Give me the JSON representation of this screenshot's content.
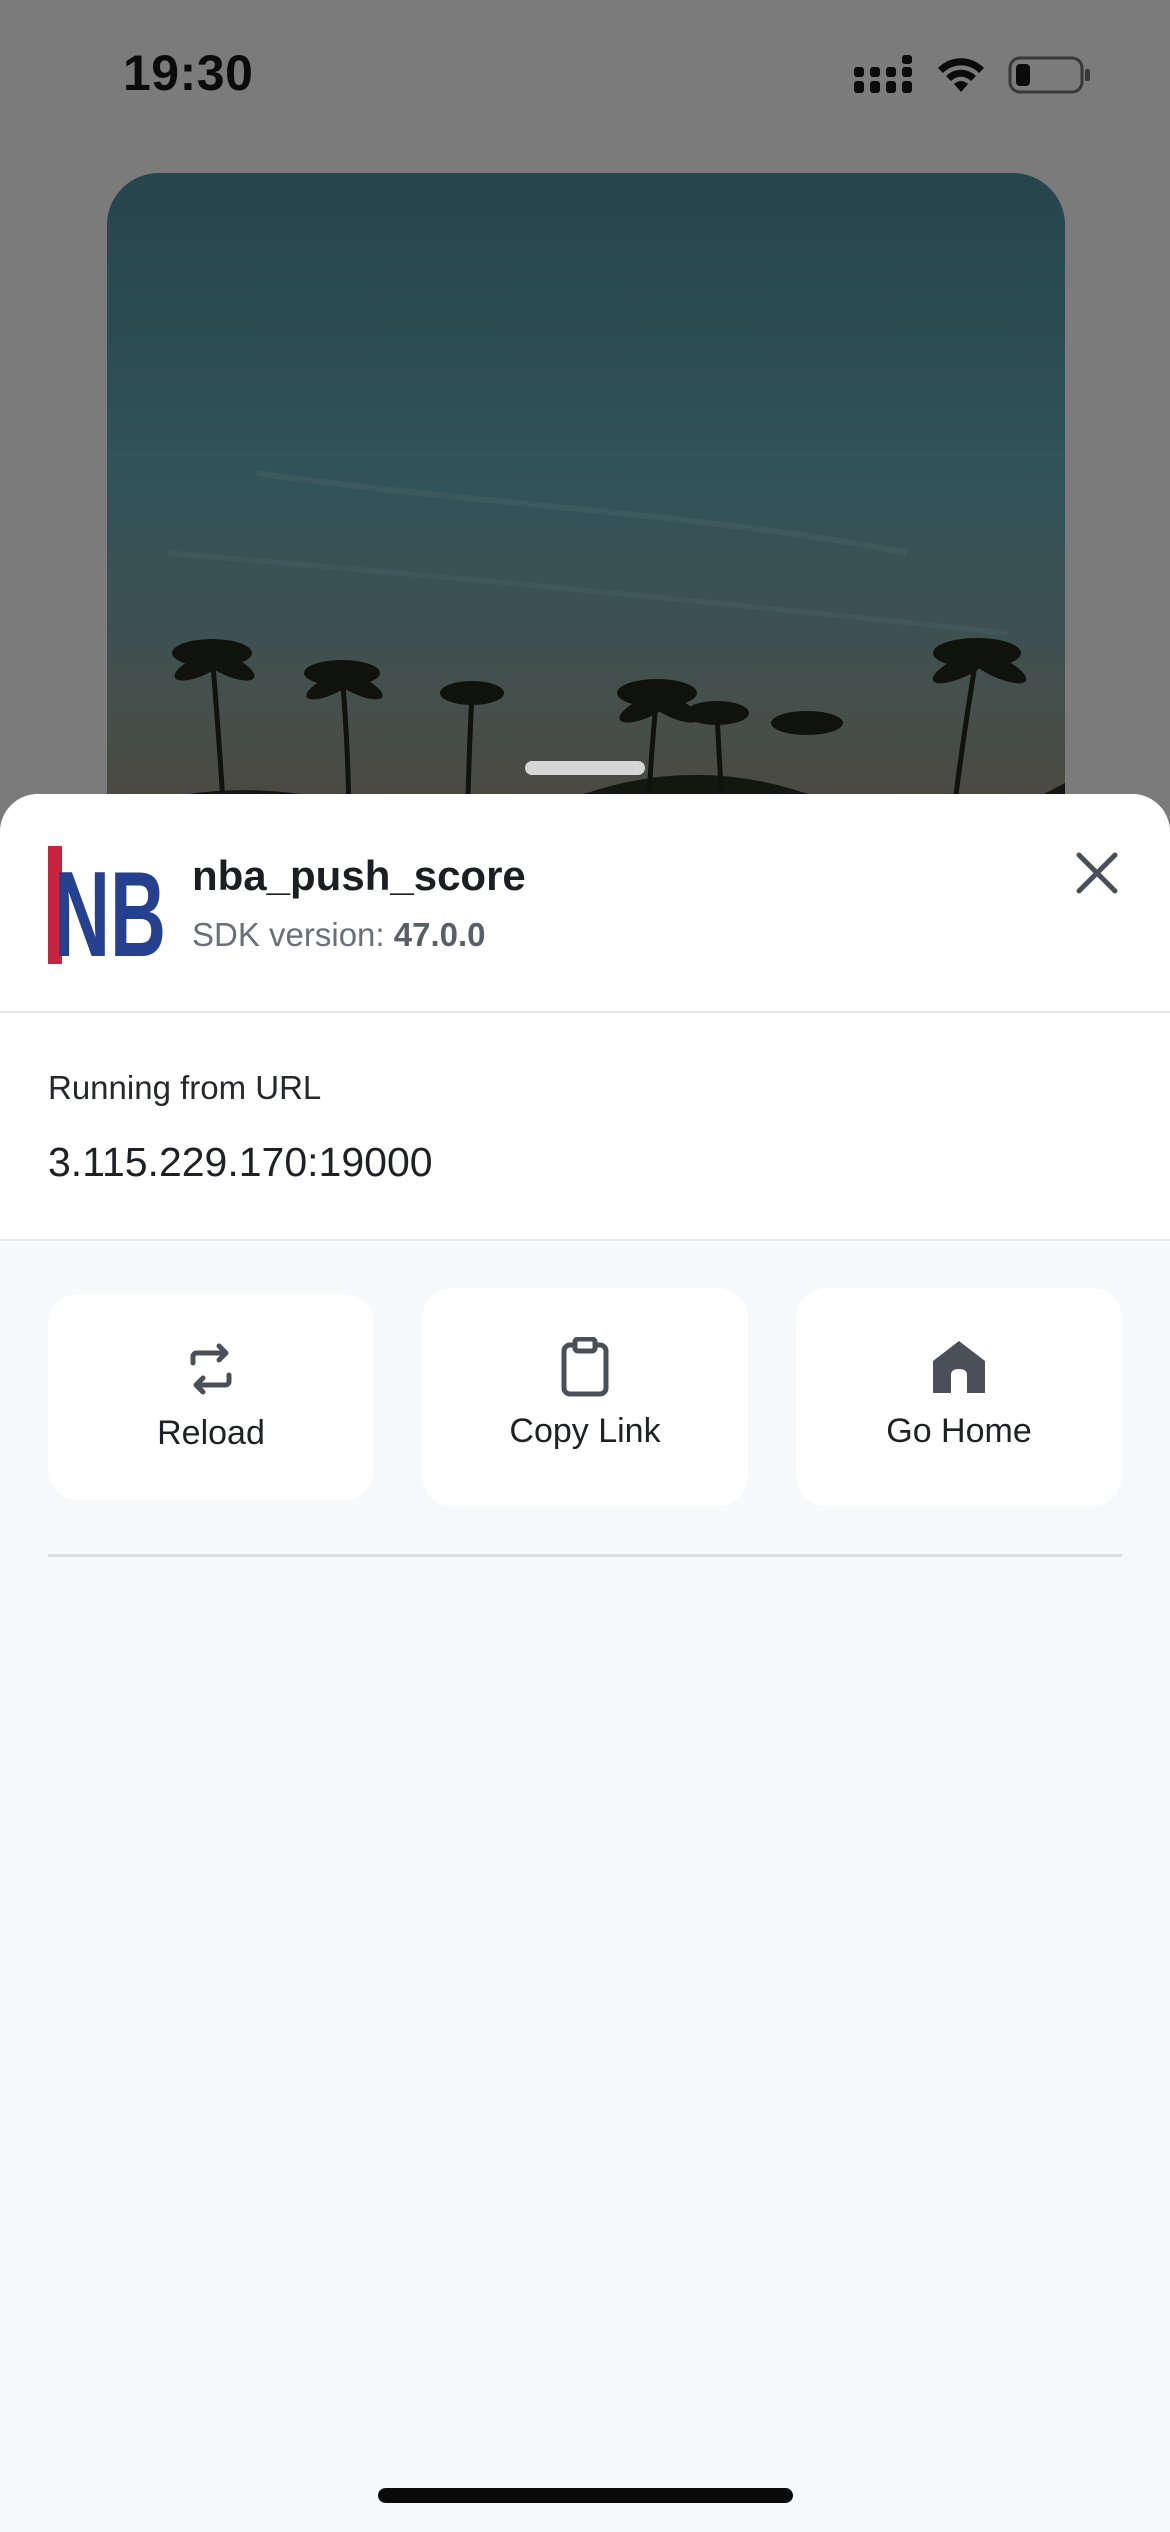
{
  "status_bar": {
    "time": "19:30",
    "icons": [
      "cellular-signal-icon",
      "wifi-icon",
      "battery-icon"
    ]
  },
  "background": {
    "content": "palm-tree-sunset-image"
  },
  "sheet": {
    "app": {
      "name": "nba_push_score",
      "logo_text": "NB",
      "sdk_label": "SDK version: ",
      "sdk_version": "47.0.0"
    },
    "close_icon": "close-icon",
    "url": {
      "label": "Running from URL",
      "value": "3.115.229.170:19000"
    },
    "actions": [
      {
        "label": "Reload",
        "icon": "reload-icon"
      },
      {
        "label": "Copy Link",
        "icon": "clipboard-icon"
      },
      {
        "label": "Go Home",
        "icon": "home-icon"
      }
    ]
  },
  "colors": {
    "overlay": "#7b7b7b",
    "sheet_bg": "#f7f8fa",
    "card_bg": "#ffffff",
    "text_primary": "#1d1e22",
    "text_secondary": "#6b6f78",
    "logo_blue": "#24408e",
    "logo_red": "#c9243f"
  }
}
